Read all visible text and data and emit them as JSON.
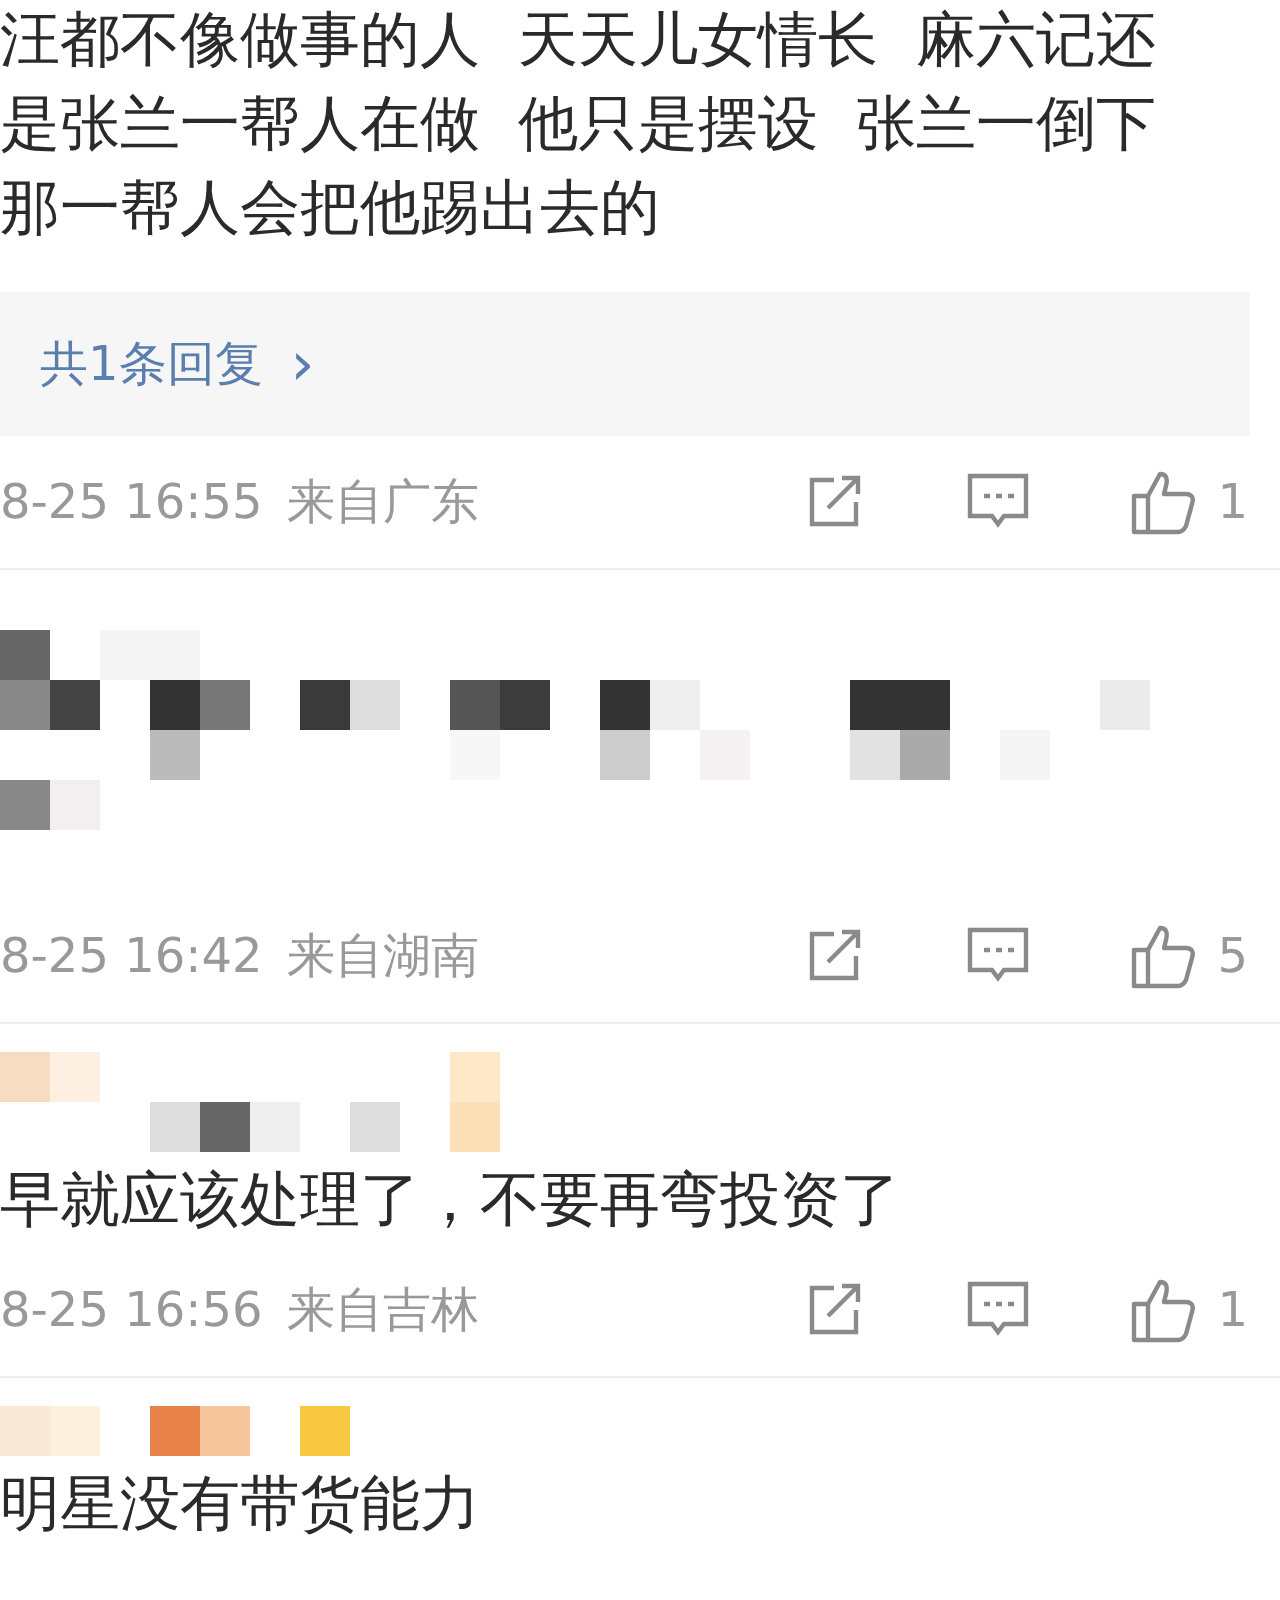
{
  "comments": [
    {
      "name_pixelated": false,
      "body_pixelated": false,
      "text": "汪都不像做事的人  天天儿女情长  麻六记还是张兰一帮人在做  他只是摆设  张兰一倒下那一帮人会把他踢出去的",
      "replies": "共1条回复",
      "reply_arrow": "›",
      "time": "8-25 16:55",
      "location": "来自广东",
      "likes": "1"
    },
    {
      "name_pixelated": false,
      "body_pixelated": true,
      "time": "8-25 16:42",
      "location": "来自湖南",
      "likes": "5"
    },
    {
      "name_pixelated": true,
      "body_pixelated": false,
      "text": "早就应该处理了，不要再弯投资了",
      "time": "8-25 16:56",
      "location": "来自吉林",
      "likes": "1"
    },
    {
      "name_pixelated": true,
      "body_pixelated": false,
      "text": "明星没有带货能力"
    }
  ]
}
